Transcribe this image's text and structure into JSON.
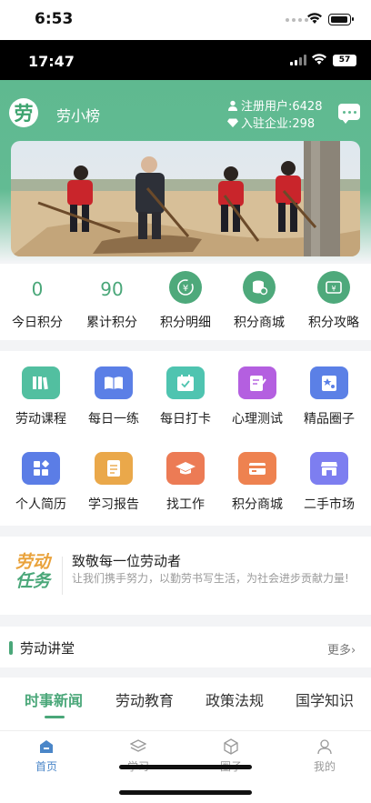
{
  "ios_status": {
    "time": "6:53"
  },
  "app_status": {
    "time": "17:47",
    "battery": "57"
  },
  "header": {
    "logo_char": "劳",
    "app_name": "劳小榜",
    "registered_users": "注册用户:6428",
    "enterprises": "入驻企业:298"
  },
  "scores": [
    {
      "value": "0",
      "label": "今日积分"
    },
    {
      "value": "90",
      "label": "累计积分"
    },
    {
      "icon": "yen-cycle-icon",
      "label": "积分明细"
    },
    {
      "icon": "coin-stack-icon",
      "label": "积分商城"
    },
    {
      "icon": "ticket-icon",
      "label": "积分攻略"
    }
  ],
  "grid": [
    {
      "label": "劳动课程",
      "icon": "books-icon",
      "color": "#52bfa0"
    },
    {
      "label": "每日一练",
      "icon": "open-book-icon",
      "color": "#5b7fe6"
    },
    {
      "label": "每日打卡",
      "icon": "calendar-check-icon",
      "color": "#4fc4b0"
    },
    {
      "label": "心理测试",
      "icon": "edit-note-icon",
      "color": "#b45fe0"
    },
    {
      "label": "精品圈子",
      "icon": "profile-card-icon",
      "color": "#5b80e6"
    },
    {
      "label": "个人简历",
      "icon": "apps-icon",
      "color": "#5b7de6"
    },
    {
      "label": "学习报告",
      "icon": "report-icon",
      "color": "#eaa84a"
    },
    {
      "label": "找工作",
      "icon": "graduation-cap-icon",
      "color": "#ec7b55"
    },
    {
      "label": "积分商城",
      "icon": "store-card-icon",
      "color": "#ee8250"
    },
    {
      "label": "二手市场",
      "icon": "shop-icon",
      "color": "#7d7ef0"
    }
  ],
  "task": {
    "logo_line1": "劳动",
    "logo_line2": "任务",
    "title": "致敬每一位劳动者",
    "desc": "让我们携手努力，以勤劳书写生活，为社会进步贡献力量!"
  },
  "lecture": {
    "title": "劳动讲堂",
    "more": "更多›"
  },
  "news_tabs": [
    "时事新闻",
    "劳动教育",
    "政策法规",
    "国学知识"
  ],
  "bottom_nav": [
    "首页",
    "学习",
    "圈子",
    "我的"
  ],
  "colors": {
    "brand_green": "#4aa779",
    "header_green": "#5fb990",
    "nav_active": "#4a86c8"
  }
}
